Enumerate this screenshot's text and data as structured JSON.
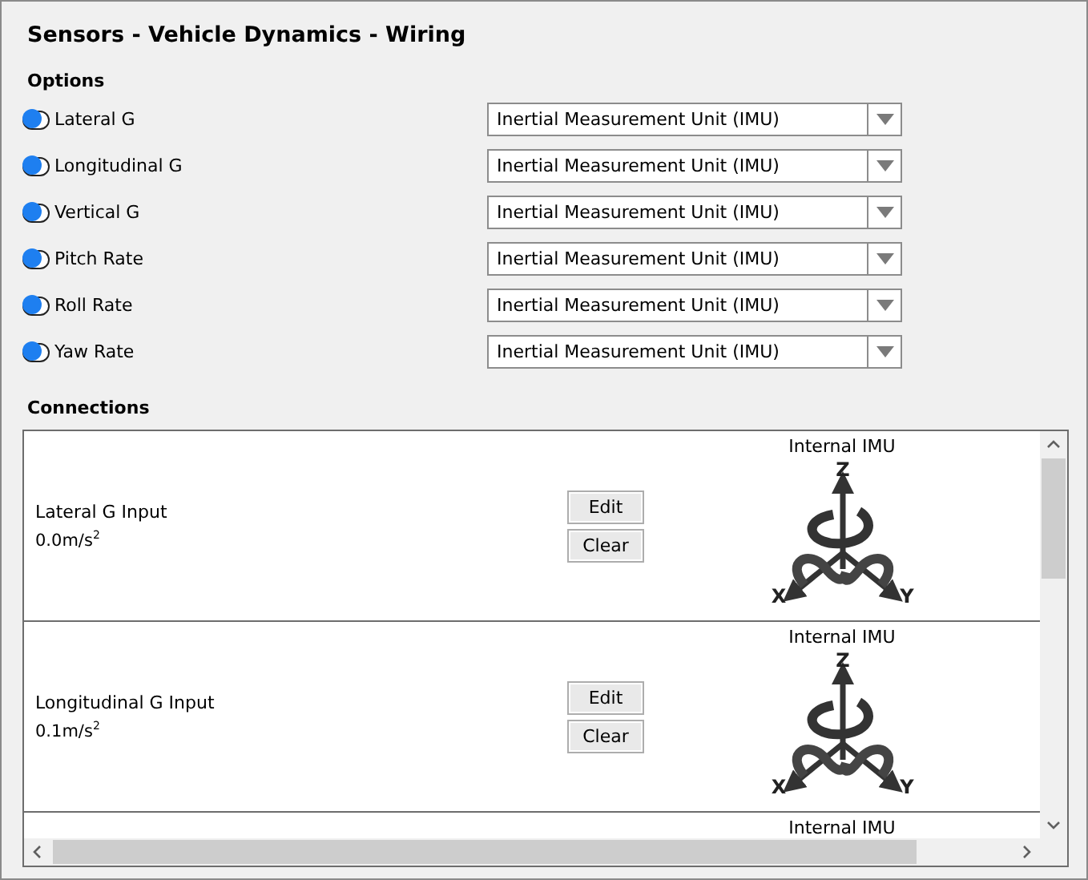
{
  "window": {
    "title": "Sensors - Vehicle Dynamics - Wiring"
  },
  "options": {
    "heading": "Options",
    "items": [
      {
        "label": "Lateral G",
        "on": true,
        "source": "Inertial Measurement Unit (IMU)"
      },
      {
        "label": "Longitudinal G",
        "on": true,
        "source": "Inertial Measurement Unit (IMU)"
      },
      {
        "label": "Vertical G",
        "on": true,
        "source": "Inertial Measurement Unit (IMU)"
      },
      {
        "label": "Pitch Rate",
        "on": true,
        "source": "Inertial Measurement Unit (IMU)"
      },
      {
        "label": "Roll Rate",
        "on": true,
        "source": "Inertial Measurement Unit (IMU)"
      },
      {
        "label": "Yaw Rate",
        "on": true,
        "source": "Inertial Measurement Unit (IMU)"
      }
    ]
  },
  "connections": {
    "heading": "Connections",
    "items": [
      {
        "name": "Lateral G Input",
        "value": "0.0m/s$^{2}$",
        "buttons": [
          "Edit",
          "Clear"
        ],
        "device": "Internal IMU",
        "axes": {
          "x": "X",
          "y": "Y",
          "z": "Z"
        }
      },
      {
        "name": "Longitudinal G Input",
        "value": "0.1m/s$^{2}$",
        "buttons": [
          "Edit",
          "Clear"
        ],
        "device": "Internal IMU",
        "axes": {
          "x": "X",
          "y": "Y",
          "z": "Z"
        }
      },
      {
        "device": "Internal IMU"
      }
    ]
  }
}
